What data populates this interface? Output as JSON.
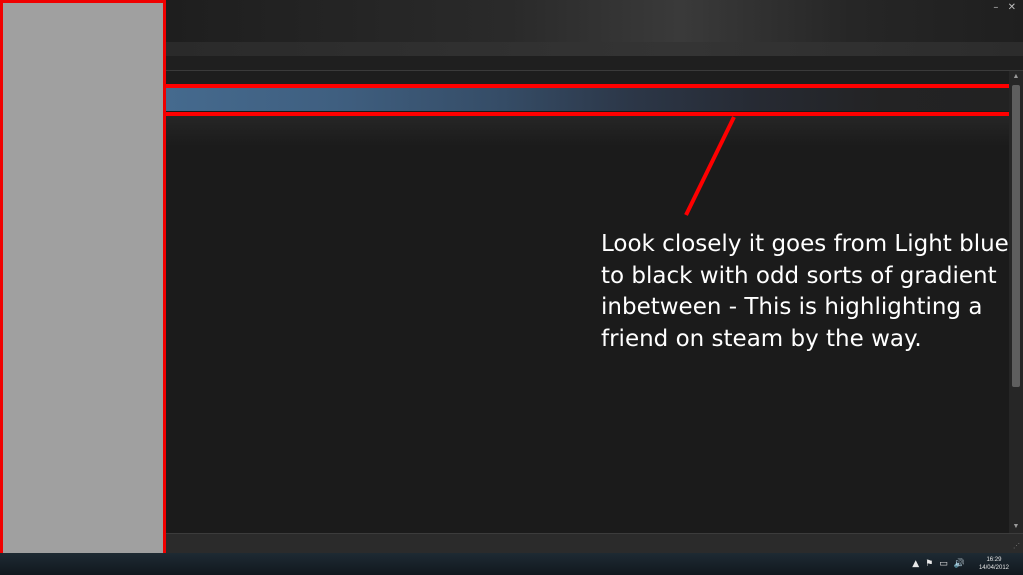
{
  "window": {
    "minimize_label": "–",
    "close_label": "✕"
  },
  "annotation": {
    "text": "Look closely it goes from Light blue\nto black with odd sorts of gradient\ninbetween - This is highlighting a\nfriend on steam by the way.",
    "color": "#ffffff"
  },
  "highlight": {
    "color": "#ff0000",
    "gradient_start": "#456a8e",
    "gradient_end": "#222222"
  },
  "left_panel": {
    "fill": "#a0a0a0",
    "border": "#f00000"
  },
  "scrollbar": {
    "up_arrow": "▲",
    "down_arrow": "▼"
  },
  "taskbar": {
    "tray_icons": [
      "chevron-up-icon",
      "flag-icon",
      "network-icon",
      "speaker-icon"
    ],
    "tray_glyphs": [
      "▲",
      "⚑",
      "▭",
      "🔊"
    ],
    "time": "16:29",
    "date": "14/04/2012"
  }
}
